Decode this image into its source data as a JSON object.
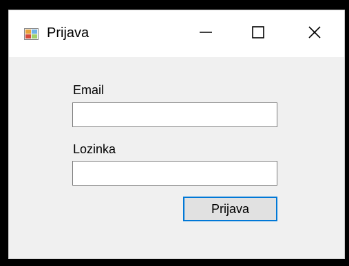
{
  "window": {
    "title": "Prijava",
    "icon": "windows-form-icon",
    "controls": {
      "minimize_icon": "minimize-icon",
      "maximize_icon": "maximize-icon",
      "close_icon": "close-icon"
    }
  },
  "form": {
    "email_label": "Email",
    "email_value": "",
    "password_label": "Lozinka",
    "password_value": "",
    "submit_label": "Prijava"
  },
  "colors": {
    "titlebar": "#ffffff",
    "client_area": "#f0f0f0",
    "button_focus_border": "#0078d7",
    "button_face": "#e1e1e1"
  }
}
